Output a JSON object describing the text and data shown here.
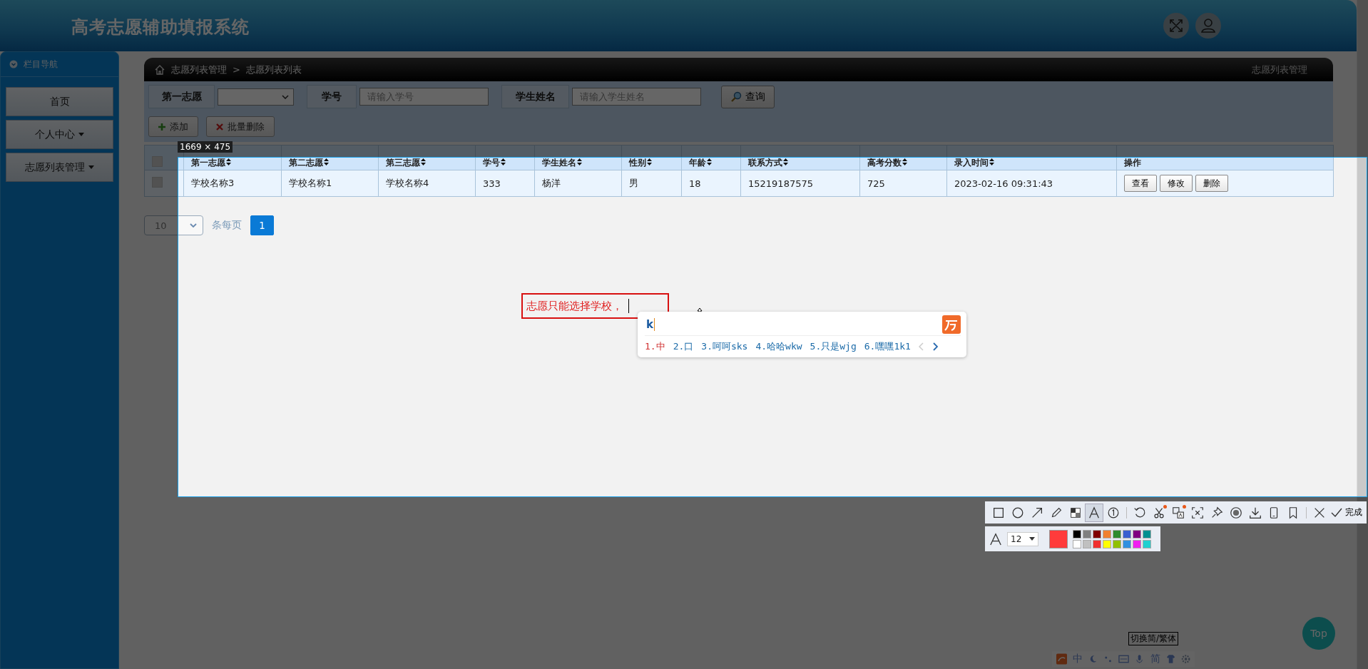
{
  "app": {
    "title": "高考志愿辅助填报系统"
  },
  "sidebar": {
    "title": "栏目导航",
    "items": [
      {
        "label": "首页",
        "has_menu": false
      },
      {
        "label": "个人中心",
        "has_menu": true
      },
      {
        "label": "志愿列表管理",
        "has_menu": true
      }
    ]
  },
  "breadcrumb": {
    "items": [
      "志愿列表管理",
      "志愿列表列表"
    ],
    "separator": ">",
    "page_title": "志愿列表管理"
  },
  "filters": [
    {
      "label": "第一志愿",
      "kind": "select"
    },
    {
      "label": "学号",
      "kind": "input",
      "placeholder": "请输入学号"
    },
    {
      "label": "学生姓名",
      "kind": "input",
      "placeholder": "请输入学生姓名"
    }
  ],
  "search_button": "查询",
  "actions": [
    {
      "label": "添加",
      "kind": "add"
    },
    {
      "label": "批量删除",
      "kind": "delete"
    }
  ],
  "table": {
    "header_checked": false,
    "columns": [
      "第一志愿",
      "第二志愿",
      "第三志愿",
      "学号",
      "学生姓名",
      "性别",
      "年龄",
      "联系方式",
      "高考分数",
      "录入时间",
      "操作"
    ],
    "rows": [
      {
        "checked": false,
        "cells": [
          "学校名称3",
          "学校名称1",
          "学校名称4",
          "333",
          "杨洋",
          "男",
          "18",
          "15219187575",
          "725",
          "2023-02-16 09:31:43"
        ],
        "actions": [
          "查看",
          "修改",
          "删除"
        ]
      }
    ]
  },
  "pagination": {
    "page_size": "10",
    "per_page_label": "条每页",
    "pages": [
      {
        "label": "1",
        "selected": true
      }
    ]
  },
  "top_button": "Top",
  "ime_status": {
    "mode": "中",
    "charset": "简"
  },
  "screenshot_tool": {
    "size_label": "1669 × 475",
    "text_annotation": "志愿只能选择学校，",
    "tools": [
      {
        "kind": "rect",
        "selected": false,
        "badge": false
      },
      {
        "kind": "ellipse",
        "selected": false,
        "badge": false
      },
      {
        "kind": "arrow",
        "selected": false,
        "badge": false
      },
      {
        "kind": "pencil",
        "selected": false,
        "badge": false
      },
      {
        "kind": "mosaic",
        "selected": false,
        "badge": false
      },
      {
        "kind": "text",
        "selected": true,
        "badge": false
      },
      {
        "kind": "number",
        "selected": false,
        "badge": false
      },
      {
        "kind": "sep"
      },
      {
        "kind": "undo",
        "selected": false,
        "badge": false
      },
      {
        "kind": "cut",
        "selected": false,
        "badge": true
      },
      {
        "kind": "translate",
        "selected": false,
        "badge": true
      },
      {
        "kind": "ocr",
        "selected": false,
        "badge": false
      },
      {
        "kind": "pin",
        "selected": false,
        "badge": false
      },
      {
        "kind": "record",
        "selected": false,
        "badge": false
      },
      {
        "kind": "download",
        "selected": false,
        "badge": false
      },
      {
        "kind": "phone",
        "selected": false,
        "badge": false
      },
      {
        "kind": "bookmark",
        "selected": false,
        "badge": false
      },
      {
        "kind": "sep"
      },
      {
        "kind": "close",
        "selected": false,
        "badge": false
      }
    ],
    "done_label": "完成",
    "font_size": "12",
    "current_swatch": {
      "color": "#ff3b3b"
    },
    "palette": [
      {
        "color": "#000000"
      },
      {
        "color": "#808080"
      },
      {
        "color": "#800000"
      },
      {
        "color": "#f08030"
      },
      {
        "color": "#2e8b2e"
      },
      {
        "color": "#3a5fd0"
      },
      {
        "color": "#800080"
      },
      {
        "color": "#009090"
      },
      {
        "color": "#ffffff"
      },
      {
        "color": "#c0c0c0"
      },
      {
        "color": "#f03030"
      },
      {
        "color": "#ffff00"
      },
      {
        "color": "#90c000"
      },
      {
        "color": "#3090e0"
      },
      {
        "color": "#f020f0"
      },
      {
        "color": "#20d0d0"
      }
    ]
  },
  "ime": {
    "input": "k",
    "candidates": [
      {
        "label": "1.中",
        "selected": true
      },
      {
        "label": "2.口",
        "selected": false
      },
      {
        "label": "3.呵呵sks",
        "selected": false
      },
      {
        "label": "4.哈哈wkw",
        "selected": false
      },
      {
        "label": "5.只是wjg",
        "selected": false
      },
      {
        "label": "6.嘿嘿1k1",
        "selected": false
      }
    ]
  },
  "tooltip": "切换简/繁体"
}
